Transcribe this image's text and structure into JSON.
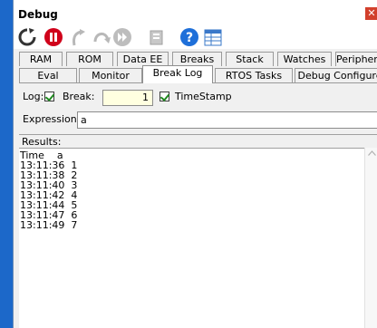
{
  "window": {
    "title": "Debug",
    "close_glyph": "✕"
  },
  "toolbar": {
    "buttons": [
      {
        "icon": "refresh-icon"
      },
      {
        "icon": "stop-icon",
        "color": "#d0021b"
      },
      {
        "icon": "step-into-icon"
      },
      {
        "icon": "step-over-icon"
      },
      {
        "icon": "fast-forward-icon"
      },
      {
        "icon": "breakpoint-icon"
      },
      {
        "icon": "help-icon",
        "color": "#1e6fd9"
      },
      {
        "icon": "table-icon"
      }
    ]
  },
  "tabs_row1": [
    "RAM",
    "ROM",
    "Data EE",
    "Breaks",
    "Stack",
    "Watches",
    "Peripherals"
  ],
  "tabs_row2": [
    "Eval",
    "Monitor",
    "Break Log",
    "RTOS Tasks",
    "Debug Configure"
  ],
  "active_tab": "Break Log",
  "break_log": {
    "log_label": "Log:",
    "log_checked": true,
    "break_label": "Break:",
    "break_value": "1",
    "timestamp_label": "TimeStamp",
    "timestamp_checked": true,
    "expression_label": "Expression:",
    "expression_value": "a",
    "results_label": "Results:",
    "results_lines": [
      "Time    a",
      "13:11:36  1",
      "13:11:38  2",
      "13:11:40  3",
      "13:11:42  4",
      "13:11:44  5",
      "13:11:47  6",
      "13:11:49  7"
    ]
  },
  "colors": {
    "desktop": "#1c68c9",
    "accent_stop": "#d0021b",
    "help": "#1e6fd9"
  }
}
